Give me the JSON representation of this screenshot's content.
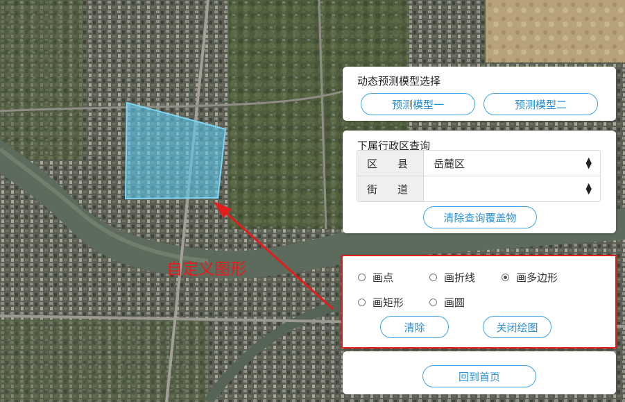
{
  "annotation": {
    "text": "自定义图形",
    "color": "#e31c1c"
  },
  "model_panel": {
    "title": "动态预测模型选择",
    "buttons": [
      "预测模型一",
      "预测模型二"
    ]
  },
  "admin_panel": {
    "title": "下属行政区查询",
    "rows": [
      {
        "label_chars": [
          "区",
          "县"
        ],
        "value": "岳麓区"
      },
      {
        "label_chars": [
          "街",
          "道"
        ],
        "value": ""
      }
    ],
    "clear_button": "清除查询覆盖物"
  },
  "draw_panel": {
    "options": [
      {
        "label": "画点",
        "selected": false
      },
      {
        "label": "画折线",
        "selected": false
      },
      {
        "label": "画多边形",
        "selected": true
      },
      {
        "label": "画矩形",
        "selected": false
      },
      {
        "label": "画圆",
        "selected": false
      }
    ],
    "clear_button": "清除",
    "close_button": "关闭绘图",
    "highlight_color": "#e31c1c"
  },
  "home_panel": {
    "button": "回到首页"
  },
  "accent_color": "#3aa3e3"
}
